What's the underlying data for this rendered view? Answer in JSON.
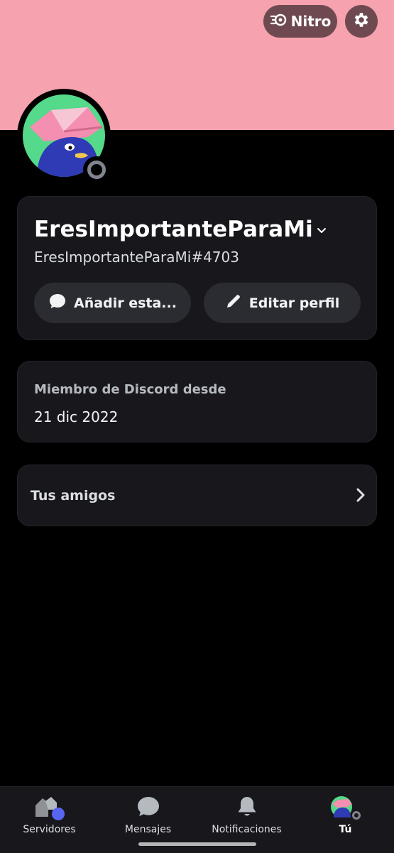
{
  "header": {
    "nitro_label": "Nitro",
    "nitro_icon": "nitro-icon",
    "settings_icon": "gear-icon",
    "banner_color": "#f6a2af"
  },
  "profile": {
    "display_name": "EresImportanteParaMi",
    "username": "EresImportanteParaMi#4703",
    "status": "offline",
    "add_status_label": "Añadir esta...",
    "edit_profile_label": "Editar perfil"
  },
  "member": {
    "label": "Miembro de Discord desde",
    "date": "21 dic 2022"
  },
  "friends": {
    "label": "Tus amigos"
  },
  "nav": {
    "items": [
      {
        "label": "Servidores",
        "icon": "servers-icon"
      },
      {
        "label": "Mensajes",
        "icon": "messages-icon"
      },
      {
        "label": "Notificaciones",
        "icon": "bell-icon"
      },
      {
        "label": "Tú",
        "icon": "avatar"
      }
    ]
  },
  "colors": {
    "accent": "#5865f2",
    "card_bg": "#18181c",
    "pill_bg": "#2b2c32"
  }
}
